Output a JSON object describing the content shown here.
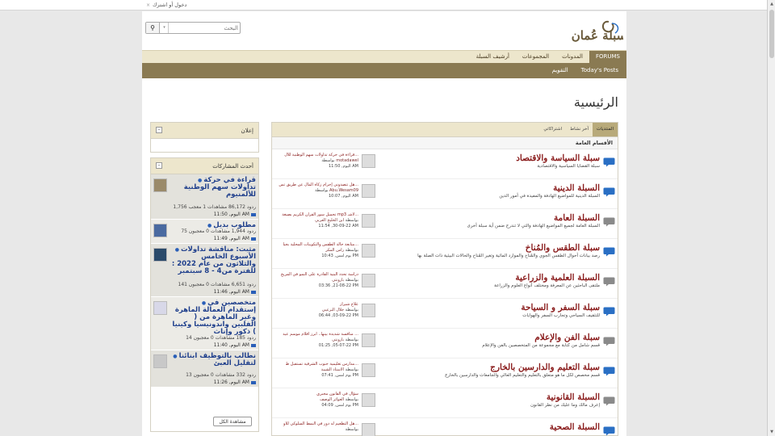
{
  "topbar": {
    "close_glyph": "×",
    "login": "دخول أو اشترك"
  },
  "search": {
    "placeholder": "البحث",
    "button_icon": "search-icon",
    "dropdown_glyph": "▾"
  },
  "logo": {
    "text": "سبلة عُمان"
  },
  "nav": {
    "tabs": [
      {
        "label": "FORUMS",
        "active": true
      },
      {
        "label": "المدونات"
      },
      {
        "label": "المجموعات"
      },
      {
        "label": "أرشيف السبلة"
      }
    ],
    "subtabs": [
      "Today's Posts",
      "التقويم"
    ]
  },
  "page": {
    "title": "الرئيسية"
  },
  "forum_tabs": [
    {
      "label": "المنتديات",
      "active": true
    },
    {
      "label": "آخر نشاط"
    },
    {
      "label": "اشتراكاتي"
    }
  ],
  "section_title": "الأقسام العامة",
  "forums": [
    {
      "name": "سبلة السياسة والاقتصاد",
      "desc": "سبلة القضايا السياسية والاقتصادية",
      "lp_title": "قراءة في حركة تداولات سهم الوطنية للأل...",
      "lp_author": "motadawel",
      "lp_date": "اليوم, 11:50 AM"
    },
    {
      "name": "السبلة الدينية",
      "desc": "السبلة الدينية للمواضيع الهادفة والمفيدة في أمور الدين",
      "lp_title": "هل تتصدوني إحرام زكاة المال عن طريق تس...",
      "lp_author": "Abu.Wesam09",
      "lp_date": "اليوم, 10:07 AM"
    },
    {
      "name": "السبلة العامة",
      "desc": "السبلة العامة لجميع المواضيع الهادفة والتي لا تندرج ضمن أية سبلة أخرى",
      "lp_title": "تحميل سور القرآن الكريم بصيغة mp3 لاشـ...",
      "lp_author": "ابن الخليج العربي",
      "lp_date": "11:54 ,30-09-22 AM"
    },
    {
      "name": "سبلة الطقس والمُناخ",
      "desc": "رصد بيانات أحوال الطقس الجوي والمُناخ والموارد المائية وتغير المُناخ والحالات البيئية ذات الصلة بها",
      "lp_title": "متابعة حالة الطقس والتكوينات المحلية بجبا...",
      "lp_author": "رأس المكر",
      "lp_date": "يوم أمس, 10:43 PM"
    },
    {
      "name": "السبلة العلمية والزراعية",
      "desc": "ملتقى الباحثين عن المعرفة ومختلف أنواع العلوم والزراعة",
      "lp_title": "دراسة تحدد البنية القادرة على النمو في المريخ",
      "lp_author": "بارونتي",
      "lp_date": "03:36 ,21-08-22 PM"
    },
    {
      "name": "سبلة السفر و السياحة",
      "desc": "للتثقيف السياحي وتجارب السفر والهوايات",
      "lp_title": "علاج شيراز",
      "lp_author": "جلال البرعيي",
      "lp_date": "06:44 ,03-09-22 PM"
    },
    {
      "name": "سبلة الفن والإعلام",
      "desc": "قسم شامل من كتابة مع مجموعة من المتخصصين بالفن والإعلام",
      "lp_title": "منافسة شديدة بينها.. أبرز أفلام موسم عيد ...",
      "lp_author": "بارونتي",
      "lp_date": "01:25 ,05-07-22 PM"
    },
    {
      "name": "سبلة التعليم والدارسين بالخارج",
      "desc": "قسم مخصص لكل ما هو متعلق بالتعليم والتعليم العالي والجامعات والدارسين بالخارج",
      "lp_title": "مدارس تعليمية جنوب الشرقية تستقبل ط...",
      "lp_author": "الاستاذ الشيبة",
      "lp_date": "يوم أمس, 07:41 PM"
    },
    {
      "name": "السبلة القانونية",
      "desc": "إعرف مالك وما عليك من نظر القانون",
      "lp_title": "سؤال في القانون مجبري",
      "lp_author": "العوائر الوصف",
      "lp_date": "يوم أمس, 04:09 PM"
    },
    {
      "name": "السبلة الصحية",
      "desc": "",
      "lp_title": "هل التطعيم له دور في النمط السلوكي للأو...",
      "lp_author": "",
      "lp_date": ""
    }
  ],
  "last_post_labels": {
    "by": "بواسطة"
  },
  "ad_box": {
    "title": "إعلان"
  },
  "recent": {
    "title": "أحدث المشاركات",
    "items": [
      {
        "title": "قراءة في حركة تداولات سهم الوطنية للألمنيوم",
        "stats": "1,756 ردود 86,172 مشاهدات 1 معجب",
        "date": "اليوم, 11:50 AM"
      },
      {
        "title": "مطلوب بديل",
        "stats": "75 ردود 1,944 مشاهدات 0 معجبون",
        "date": "اليوم, 11:49 AM"
      },
      {
        "title": "مثبت: مناقشة تداولات الأسبوع الخامس والثلاثون من عام 2022 : للفترة من4 - 8 سبتمبر",
        "stats": "141 ردود 6,651 مشاهدات 0 معجبون",
        "date": "اليوم, 11:46 AM"
      },
      {
        "title": "متخصصين في إستقدام العمالة الماهرة وغير الماهرة من ( الفلبين واندونيسيا وكينيا ) ذكور وإناث",
        "stats": "14 ردود 185 مشاهدات 0 معجبون",
        "date": "اليوم, 11:40 AM"
      },
      {
        "title": "نطالب بالتوظيف ابنائنا لتقليل العبئ",
        "stats": "13 ردود 332 مشاهدات 0 معجبون",
        "date": "اليوم, 11:26 AM"
      }
    ],
    "view_all": "مشاهدة الكل"
  },
  "colors": {
    "accent": "#8a7a52",
    "nav_bg": "#ede6cc",
    "forum_title": "#8a1c1c",
    "link": "#1f3f8c",
    "icon_blue": "#2a6fc4",
    "icon_gray": "#8a8a8a"
  },
  "icons": [
    "search-icon",
    "chevron-down-icon",
    "forum-bubble-icon",
    "collapse-icon",
    "post-icon"
  ]
}
